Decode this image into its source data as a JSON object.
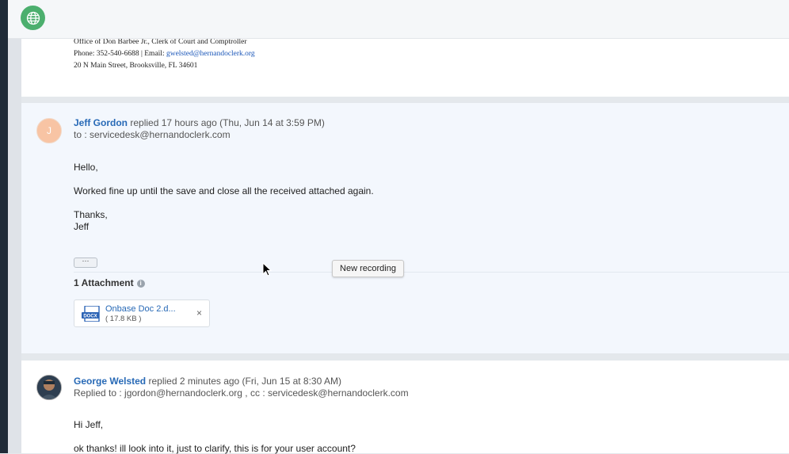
{
  "signature": {
    "line1": "Office of Don Barbee Jr., Clerk of Court and Comptroller",
    "phone_prefix": "Phone: 352-540-6688",
    "separator": "|",
    "email_label": "Email:",
    "email": "gwelsted@hernandoclerk.org",
    "address": "20 N Main Street, Brooksville, FL 34601"
  },
  "reply1": {
    "avatar_letter": "J",
    "author": "Jeff Gordon",
    "action": "replied 17 hours ago (Thu, Jun 14 at 3:59 PM)",
    "to_line": "to : servicedesk@hernandoclerk.com",
    "greeting": "Hello,",
    "body": "Worked fine up until the save and close all the received attached again.",
    "closing": "Thanks,",
    "sign": "Jeff",
    "more": "···",
    "attachments_title": "1 Attachment",
    "attachment": {
      "name": "Onbase Doc 2.d...",
      "size": "( 17.8 KB )",
      "type_label": "DOCX",
      "close": "×"
    }
  },
  "reply2": {
    "author": "George Welsted",
    "action": "replied 2 minutes ago (Fri, Jun 15 at 8:30 AM)",
    "to_line": "Replied to : jgordon@hernandoclerk.org , cc : servicedesk@hernandoclerk.com",
    "greeting": "Hi Jeff,",
    "body": "ok thanks! ill look into it, just to clarify, this is for your user account?"
  },
  "tooltip": "New recording",
  "colors": {
    "accent": "#2769b6",
    "globe": "#4caf6e",
    "avatar_j": "#f8c4a4"
  }
}
